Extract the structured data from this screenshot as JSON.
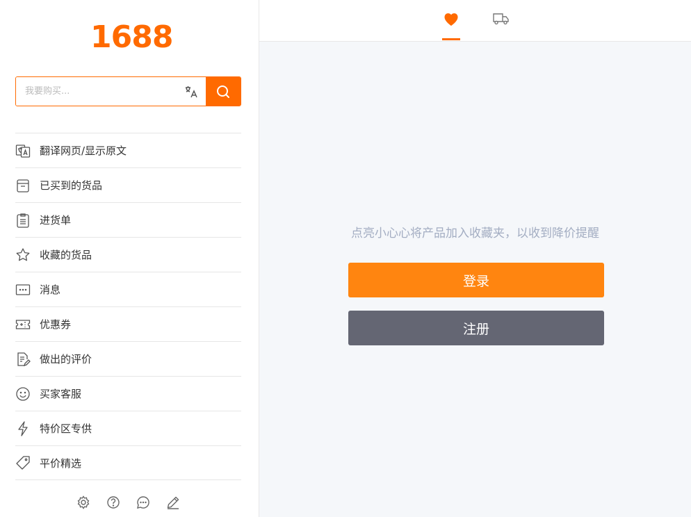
{
  "logo": {
    "text": "1688"
  },
  "search": {
    "placeholder": "我要购买..."
  },
  "menu": [
    {
      "label": "翻译网页/显示原文",
      "icon": "translate-page-icon"
    },
    {
      "label": "已买到的货品",
      "icon": "box-icon"
    },
    {
      "label": "进货单",
      "icon": "list-doc-icon"
    },
    {
      "label": "收藏的货品",
      "icon": "star-icon"
    },
    {
      "label": "消息",
      "icon": "message-icon"
    },
    {
      "label": "优惠券",
      "icon": "coupon-icon"
    },
    {
      "label": "做出的评价",
      "icon": "edit-doc-icon"
    },
    {
      "label": "买家客服",
      "icon": "smile-icon"
    },
    {
      "label": "特价区专供",
      "icon": "lightning-icon"
    },
    {
      "label": "平价精选",
      "icon": "tag-icon"
    }
  ],
  "footer_icons": [
    "settings-icon",
    "help-icon",
    "chat-icon",
    "pen-icon"
  ],
  "tabs": [
    {
      "name": "favorites",
      "icon": "heart-icon",
      "active": true
    },
    {
      "name": "shipping",
      "icon": "truck-icon",
      "active": false
    }
  ],
  "main": {
    "prompt": "点亮小心心将产品加入收藏夹，以收到降价提醒",
    "login_label": "登录",
    "register_label": "注册"
  },
  "colors": {
    "accent": "#ff6a00",
    "login": "#ff8510",
    "register": "#646673",
    "prompt": "#a3adc2"
  }
}
